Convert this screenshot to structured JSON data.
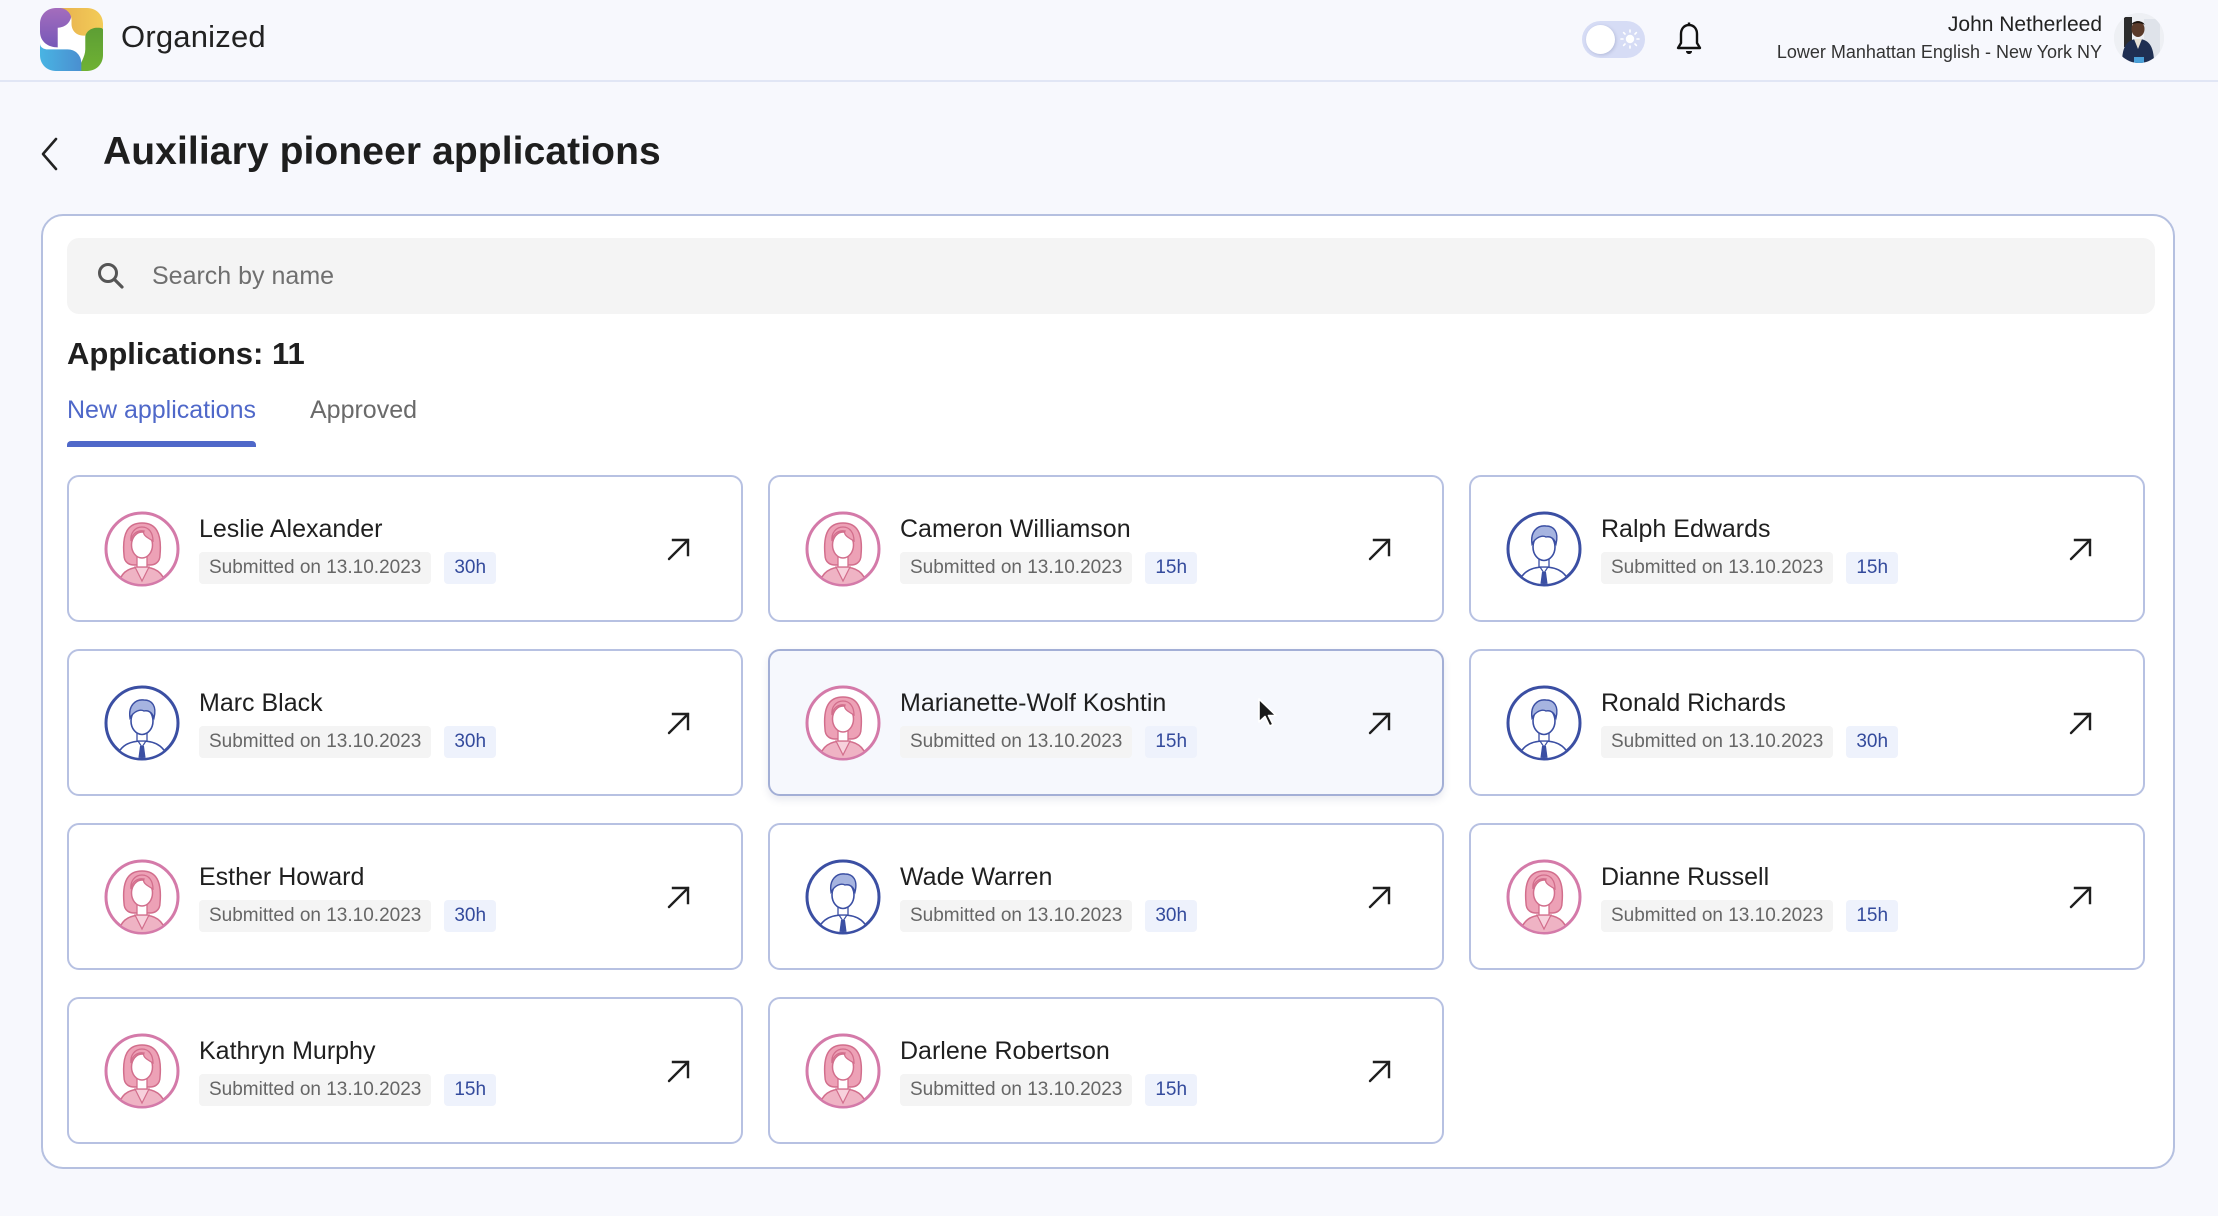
{
  "app": {
    "title": "Organized"
  },
  "header": {
    "theme_toggle": {
      "state": "light"
    },
    "user": {
      "name": "John Netherleed",
      "congregation": "Lower Manhattan English - New York NY"
    }
  },
  "page": {
    "title": "Auxiliary pioneer applications",
    "back_label": "Back"
  },
  "search": {
    "placeholder": "Search by name",
    "value": ""
  },
  "applications": {
    "count_label": "Applications: 11",
    "tabs": [
      {
        "label": "New applications",
        "active": true
      },
      {
        "label": "Approved",
        "active": false
      }
    ],
    "items": [
      {
        "name": "Leslie Alexander",
        "submitted": "Submitted on 13.10.2023",
        "hours": "30h",
        "gender": "female"
      },
      {
        "name": "Cameron Williamson",
        "submitted": "Submitted on 13.10.2023",
        "hours": "15h",
        "gender": "female"
      },
      {
        "name": "Ralph Edwards",
        "submitted": "Submitted on 13.10.2023",
        "hours": "15h",
        "gender": "male"
      },
      {
        "name": "Marc Black",
        "submitted": "Submitted on 13.10.2023",
        "hours": "30h",
        "gender": "male"
      },
      {
        "name": "Marianette-Wolf Koshtin",
        "submitted": "Submitted on 13.10.2023",
        "hours": "15h",
        "gender": "female",
        "hovered": true
      },
      {
        "name": "Ronald Richards",
        "submitted": "Submitted on 13.10.2023",
        "hours": "30h",
        "gender": "male"
      },
      {
        "name": "Esther Howard",
        "submitted": "Submitted on 13.10.2023",
        "hours": "30h",
        "gender": "female"
      },
      {
        "name": "Wade Warren",
        "submitted": "Submitted on 13.10.2023",
        "hours": "30h",
        "gender": "male"
      },
      {
        "name": "Dianne Russell",
        "submitted": "Submitted on 13.10.2023",
        "hours": "15h",
        "gender": "female"
      },
      {
        "name": "Kathryn Murphy",
        "submitted": "Submitted on 13.10.2023",
        "hours": "15h",
        "gender": "female"
      },
      {
        "name": "Darlene Robertson",
        "submitted": "Submitted on 13.10.2023",
        "hours": "15h",
        "gender": "female"
      }
    ]
  },
  "icons": {
    "logo": "organized-logo-icon",
    "theme": "sun-icon",
    "notifications": "bell-icon",
    "back": "chevron-left-icon",
    "search": "search-icon",
    "open": "arrow-up-right-icon",
    "female_avatar": "female-avatar-icon",
    "male_avatar": "male-avatar-icon"
  },
  "colors": {
    "accent": "#4f68c9",
    "hours_text": "#334a9c",
    "female_avatar": "#d47aa9",
    "male_avatar": "#3b4fa3",
    "card_border": "#b7c1e2",
    "background": "#f7f8fd"
  }
}
